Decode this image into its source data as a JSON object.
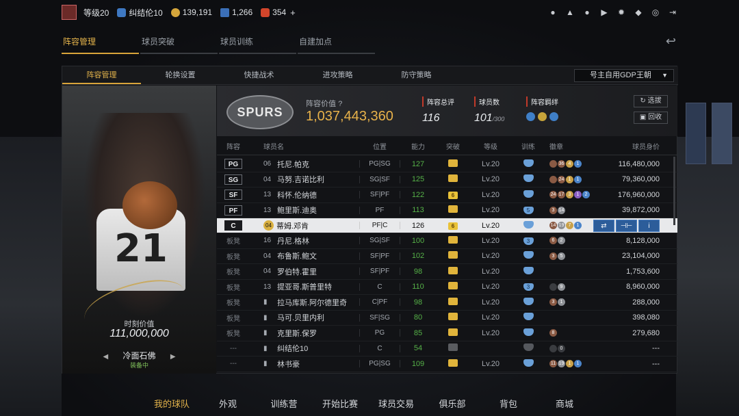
{
  "topbar": {
    "level": "等级20",
    "username": "纠结伦10",
    "gold": "139,191",
    "points": "1,266",
    "tokens": "354",
    "plus": "+"
  },
  "main_tabs": [
    "阵容管理",
    "球员突破",
    "球员训练",
    "自建加点"
  ],
  "sub_tabs": [
    "阵容管理",
    "轮换设置",
    "快捷战术",
    "进攻策略",
    "防守策略"
  ],
  "team_dropdown": "号主自用GDP王朝",
  "team": {
    "logo_text": "SPURS",
    "value_label": "阵容价值",
    "value": "1,037,443,360",
    "overall_label": "阵容总评",
    "overall": "116",
    "count_label": "球员数",
    "count": "101",
    "count_max": "/300",
    "bond_label": "阵容羁绊",
    "select_btn": "选拔",
    "recycle_btn": "回收"
  },
  "card": {
    "jersey_number": "21",
    "value_label": "时刻价值",
    "value": "111,000,000",
    "name": "冷面石佛",
    "status": "装备中"
  },
  "table_headers": [
    "阵容",
    "球员名",
    "位置",
    "能力",
    "突破",
    "等级",
    "训练",
    "徽章",
    "球员身价"
  ],
  "players": [
    {
      "slot": "PG",
      "jersey": "06",
      "name": "托尼.帕克",
      "pos": "PG|SG",
      "ovr": "127",
      "brk": "",
      "lv": "Lv.20",
      "tr": "",
      "badges": [
        [
          "br",
          ""
        ],
        [
          "br",
          "36"
        ],
        [
          "gd",
          "4"
        ],
        [
          "bl",
          "1"
        ]
      ],
      "price": "116,480,000"
    },
    {
      "slot": "SG",
      "jersey": "04",
      "name": "马努.吉诺比利",
      "pos": "SG|SF",
      "ovr": "125",
      "brk": "",
      "lv": "Lv.20",
      "tr": "",
      "badges": [
        [
          "br",
          ""
        ],
        [
          "br",
          "24"
        ],
        [
          "gd",
          "1"
        ],
        [
          "bl",
          "1"
        ]
      ],
      "price": "79,360,000"
    },
    {
      "slot": "SF",
      "jersey": "13",
      "name": "科怀.伦纳德",
      "pos": "SF|PF",
      "ovr": "122",
      "brk": "6",
      "lv": "Lv.20",
      "tr": "",
      "badges": [
        [
          "br",
          "24"
        ],
        [
          "br",
          "17"
        ],
        [
          "gd",
          "3"
        ],
        [
          "pu",
          "1"
        ],
        [
          "bl",
          "2"
        ]
      ],
      "price": "176,960,000"
    },
    {
      "slot": "PF",
      "jersey": "13",
      "name": "鲍里斯.迪奥",
      "pos": "PF",
      "ovr": "113",
      "brk": "",
      "lv": "Lv.20",
      "tr": "5",
      "badges": [
        [
          "br",
          "3"
        ],
        [
          "sv",
          "14"
        ]
      ],
      "price": "39,872,000"
    },
    {
      "slot": "C",
      "jersey": "04",
      "name": "蒂姆.邓肯",
      "pos": "PF|C",
      "ovr": "126",
      "brk": "6",
      "lv": "Lv.20",
      "tr": "",
      "badges": [
        [
          "br",
          "14"
        ],
        [
          "sv",
          "19"
        ],
        [
          "gd",
          "7"
        ],
        [
          "bl",
          "1"
        ]
      ],
      "price": "",
      "selected": true
    },
    {
      "slot": "板凳",
      "jersey": "16",
      "name": "丹尼.格林",
      "pos": "SG|SF",
      "ovr": "100",
      "brk": "",
      "lv": "Lv.20",
      "tr": "3",
      "badges": [
        [
          "br",
          "6"
        ],
        [
          "sv",
          "2"
        ]
      ],
      "price": "8,128,000"
    },
    {
      "slot": "板凳",
      "jersey": "04",
      "name": "布鲁斯.鲍文",
      "pos": "SF|PF",
      "ovr": "102",
      "brk": "",
      "lv": "Lv.20",
      "tr": "",
      "badges": [
        [
          "br",
          "3"
        ],
        [
          "sv",
          "5"
        ]
      ],
      "price": "23,104,000"
    },
    {
      "slot": "板凳",
      "jersey": "04",
      "name": "罗伯特.霍里",
      "pos": "SF|PF",
      "ovr": "98",
      "brk": "",
      "lv": "Lv.20",
      "tr": "",
      "badges": [],
      "price": "1,753,600"
    },
    {
      "slot": "板凳",
      "jersey": "13",
      "name": "提亚哥.斯普里特",
      "pos": "C",
      "ovr": "110",
      "brk": "",
      "lv": "Lv.20",
      "tr": "3",
      "badges": [
        [
          "dk",
          ""
        ],
        [
          "sv",
          "9"
        ]
      ],
      "price": "8,960,000"
    },
    {
      "slot": "板凳",
      "jersey": "",
      "name": "拉马库斯.阿尔德里奇",
      "pos": "C|PF",
      "ovr": "98",
      "brk": "",
      "lv": "Lv.20",
      "tr": "",
      "badges": [
        [
          "br",
          "3"
        ],
        [
          "sv",
          "1"
        ]
      ],
      "price": "288,000"
    },
    {
      "slot": "板凳",
      "jersey": "",
      "name": "马可.贝里内利",
      "pos": "SF|SG",
      "ovr": "80",
      "brk": "",
      "lv": "Lv.20",
      "tr": "",
      "badges": [],
      "price": "398,080"
    },
    {
      "slot": "板凳",
      "jersey": "",
      "name": "克里斯.保罗",
      "pos": "PG",
      "ovr": "85",
      "brk": "",
      "lv": "Lv.20",
      "tr": "",
      "badges": [
        [
          "br",
          "8"
        ]
      ],
      "price": "279,680"
    },
    {
      "slot": "---",
      "jersey": "",
      "name": "纠结伦10",
      "pos": "C",
      "ovr": "54",
      "brk": "",
      "lv": "",
      "tr": "",
      "badges": [
        [
          "dk",
          ""
        ],
        [
          "dk",
          "0"
        ]
      ],
      "price": "---"
    },
    {
      "slot": "---",
      "jersey": "",
      "name": "林书豪",
      "pos": "PG|SG",
      "ovr": "109",
      "brk": "",
      "lv": "Lv.20",
      "tr": "",
      "badges": [
        [
          "br",
          "11"
        ],
        [
          "sv",
          "19"
        ],
        [
          "gd",
          "1"
        ],
        [
          "bl",
          "1"
        ]
      ],
      "price": "---"
    }
  ],
  "bottom_nav": [
    "我的球队",
    "外观",
    "训练营",
    "开始比赛",
    "球员交易",
    "俱乐部",
    "背包",
    "商城"
  ],
  "colors": {
    "accent": "#e3b34b",
    "ovr_green": "#56b248",
    "label_red": "#c23a2a"
  }
}
